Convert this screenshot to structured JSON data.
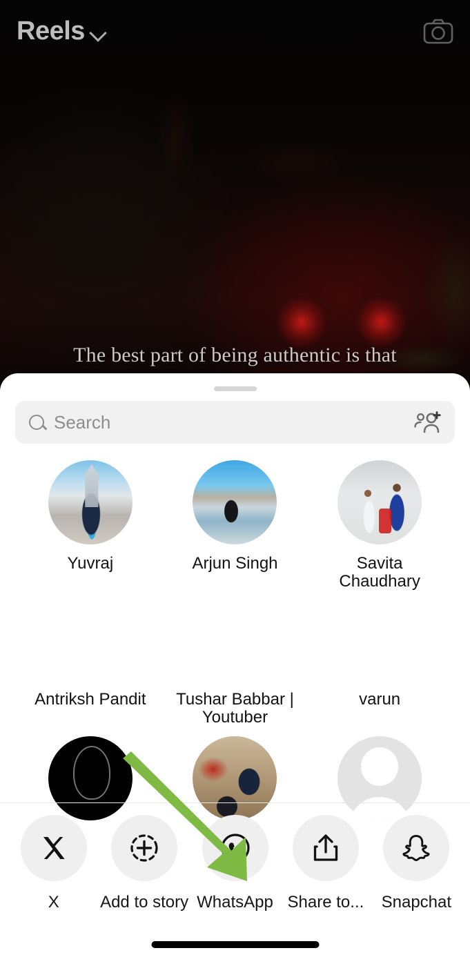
{
  "app": {
    "header": {
      "title": "Reels",
      "dropdown_icon": "chevron-down-icon",
      "camera_icon": "camera-icon"
    },
    "video": {
      "caption": "The best part of being authentic is that"
    }
  },
  "share_sheet": {
    "search": {
      "placeholder": "Search",
      "value": "",
      "search_icon": "search-icon",
      "add_people_icon": "add-people-icon"
    },
    "contacts_rows": [
      [
        {
          "name": "Yuvraj",
          "avatar": "av-yuvraj"
        },
        {
          "name": "Arjun Singh",
          "avatar": "av-arjun"
        },
        {
          "name": "Savita Chaudhary",
          "avatar": "av-savita"
        }
      ],
      [
        {
          "name": "Antriksh Pandit",
          "avatar": "av-blank"
        },
        {
          "name": "Tushar Babbar | Youtuber",
          "avatar": "av-blank"
        },
        {
          "name": "varun",
          "avatar": "av-blank"
        }
      ],
      [
        {
          "name": "",
          "avatar": "av-dark"
        },
        {
          "name": "",
          "avatar": "av-couple"
        },
        {
          "name": "",
          "avatar": "av-gray"
        }
      ]
    ],
    "share_targets": [
      {
        "label": "X",
        "icon": "x-logo-icon"
      },
      {
        "label": "Add to story",
        "icon": "add-to-story-icon"
      },
      {
        "label": "WhatsApp",
        "icon": "whatsapp-icon"
      },
      {
        "label": "Share to...",
        "icon": "share-out-icon"
      },
      {
        "label": "Snapchat",
        "icon": "snapchat-ghost-icon"
      }
    ]
  },
  "annotation": {
    "arrow_color": "#7FBA44",
    "points_to": "WhatsApp"
  },
  "colors": {
    "sheet_background": "#FFFFFF",
    "search_field": "#F1F1F1",
    "share_circle": "#EFEFEF",
    "accent_green": "#7FBA44",
    "text_primary": "#121212",
    "text_muted": "#8D8D8D"
  }
}
